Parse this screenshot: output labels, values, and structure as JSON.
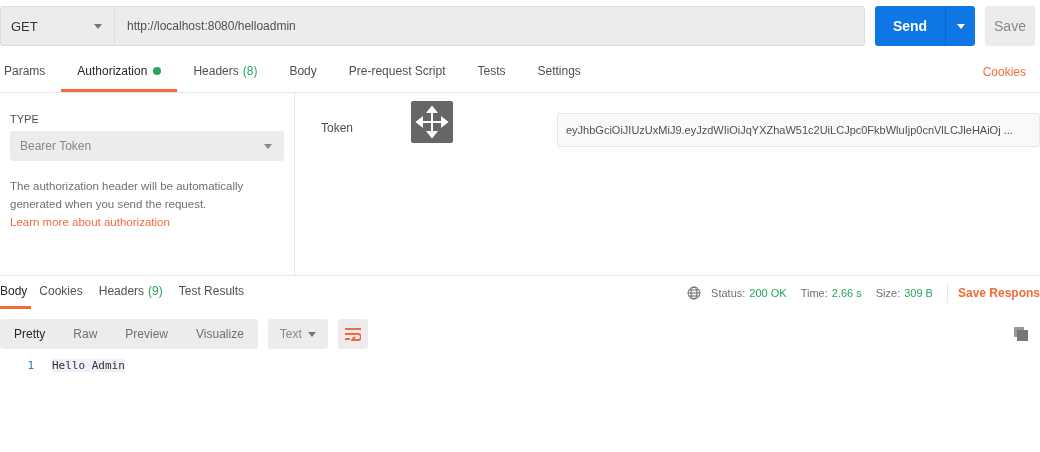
{
  "request": {
    "method": "GET",
    "url": "http://localhost:8080/helloadmin",
    "send_label": "Send",
    "save_label": "Save"
  },
  "request_tabs": [
    {
      "label": "Params",
      "selected": false
    },
    {
      "label": "Authorization",
      "selected": true,
      "dot": true
    },
    {
      "label": "Headers",
      "count": "(8)",
      "selected": false
    },
    {
      "label": "Body",
      "selected": false
    },
    {
      "label": "Pre-request Script",
      "selected": false
    },
    {
      "label": "Tests",
      "selected": false
    },
    {
      "label": "Settings",
      "selected": false
    }
  ],
  "cookies_link": "Cookies",
  "auth": {
    "type_label": "TYPE",
    "type_value": "Bearer Token",
    "help": "The authorization header will be automatically generated when you send the request.",
    "help_link": "Learn more about authorization",
    "token_label": "Token",
    "token_value": "eyJhbGciOiJIUzUxMiJ9.eyJzdWIiOiJqYXZhaW51c2UiLCJpc0FkbWluIjp0cnVlLCJleHAiOj ..."
  },
  "response_tabs": [
    {
      "label": "Body",
      "selected": true
    },
    {
      "label": "Cookies",
      "selected": false
    },
    {
      "label": "Headers",
      "count": "(9)",
      "selected": false
    },
    {
      "label": "Test Results",
      "selected": false
    }
  ],
  "status": {
    "status_label": "Status:",
    "status_value": "200 OK",
    "time_label": "Time:",
    "time_value": "2.66 s",
    "size_label": "Size:",
    "size_value": "309 B",
    "save_response": "Save Respons"
  },
  "formats": [
    {
      "label": "Pretty",
      "selected": true
    },
    {
      "label": "Raw",
      "selected": false
    },
    {
      "label": "Preview",
      "selected": false
    },
    {
      "label": "Visualize",
      "selected": false
    }
  ],
  "body_type": "Text",
  "lines": [
    {
      "number": "1",
      "text": "Hello Admin"
    }
  ]
}
